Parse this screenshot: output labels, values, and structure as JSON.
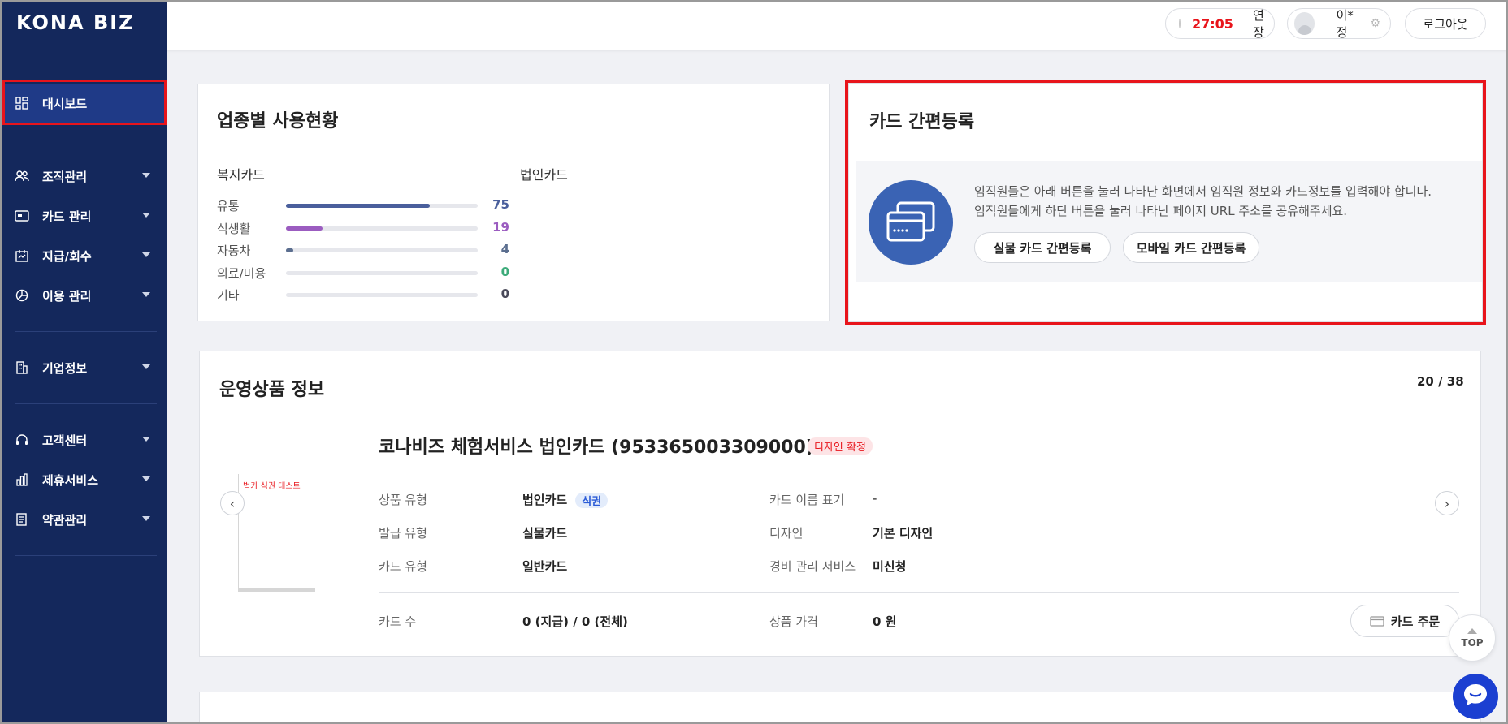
{
  "app": {
    "logo": "KONA BIZ"
  },
  "sidebar": {
    "items": [
      {
        "label": "대시보드",
        "icon": "dashboard-icon"
      },
      {
        "label": "조직관리",
        "icon": "people-icon"
      },
      {
        "label": "카드 관리",
        "icon": "card-icon"
      },
      {
        "label": "지급/회수",
        "icon": "calendar-icon"
      },
      {
        "label": "이용 관리",
        "icon": "pie-chart-icon"
      },
      {
        "label": "기업정보",
        "icon": "building-icon"
      },
      {
        "label": "고객센터",
        "icon": "headset-icon"
      },
      {
        "label": "제휴서비스",
        "icon": "chart-bars-icon"
      },
      {
        "label": "약관관리",
        "icon": "document-icon"
      }
    ]
  },
  "header": {
    "timer": "27:05",
    "extend_label": "연장",
    "user_name": "이*정",
    "logout_label": "로그아웃"
  },
  "usage": {
    "title": "업종별 사용현황",
    "welfare_label": "복지카드",
    "corporate_label": "법인카드",
    "rows": [
      {
        "label": "유통",
        "value": "75",
        "fraction": 0.75,
        "color": "#4a5f9c"
      },
      {
        "label": "식생활",
        "value": "19",
        "fraction": 0.19,
        "color": "#9b5cc0"
      },
      {
        "label": "자동차",
        "value": "4",
        "fraction": 0.04,
        "color": "#5b6e8f"
      },
      {
        "label": "의료/미용",
        "value": "0",
        "fraction": 0,
        "color": "#3dab7a"
      },
      {
        "label": "기타",
        "value": "0",
        "fraction": 0,
        "color": "#4a4a5a"
      }
    ]
  },
  "registration": {
    "title": "카드 간편등록",
    "desc1": "임직원들은 아래 버튼을 눌러 나타난 화면에서 임직원 정보와 카드정보를 입력해야 합니다.",
    "desc2": "임직원들에게 하단 버튼을 눌러 나타난 페이지 URL 주소를 공유해주세요.",
    "physical_btn": "실물 카드 간편등록",
    "mobile_btn": "모바일 카드 간편등록"
  },
  "product": {
    "title": "운영상품 정보",
    "pager": "20 / 38",
    "name": "코나비즈 체험서비스 법인카드 (953365003309000)",
    "status_badge": "디자인 확정",
    "thumb_caption": "법카 식권 테스트",
    "fields": {
      "type_label": "상품 유형",
      "type_value": "법인카드",
      "type_badge": "식권",
      "issue_label": "발급 유형",
      "issue_value": "실물카드",
      "card_type_label": "카드 유형",
      "card_type_value": "일반카드",
      "name_display_label": "카드 이름 표기",
      "name_display_value": "-",
      "design_label": "디자인",
      "design_value": "기본 디자인",
      "expense_label": "경비 관리 서비스",
      "expense_value": "미신청",
      "count_label": "카드 수",
      "count_value": "0 (지급) / 0 (전체)",
      "price_label": "상품 가격",
      "price_value": "0 원"
    },
    "order_btn": "카드 주문"
  },
  "floating": {
    "top_label": "TOP"
  }
}
